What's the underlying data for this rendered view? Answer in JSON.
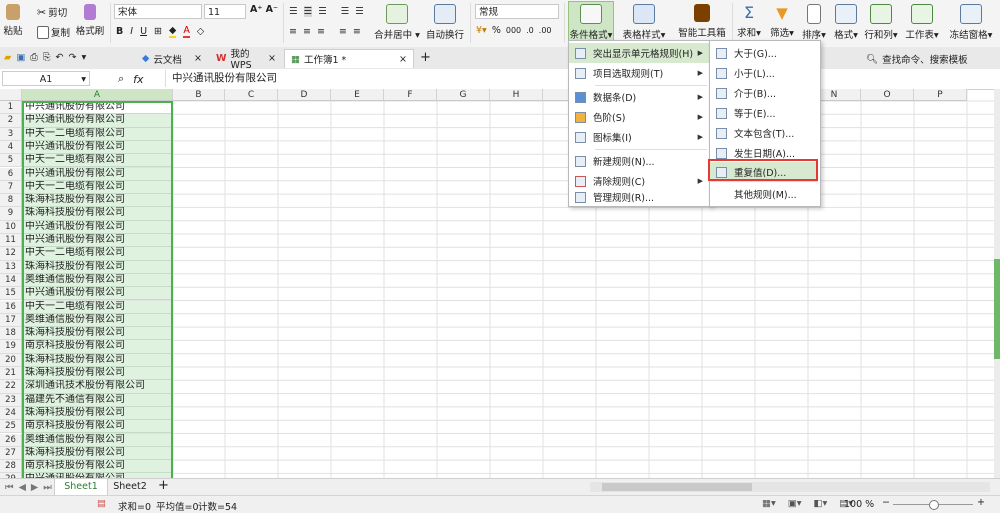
{
  "ribbon": {
    "cut": "剪切",
    "paste": "粘贴",
    "copy": "复制",
    "format_painter": "格式刷",
    "font_name": "宋体",
    "font_size": "11",
    "number_format": "常规",
    "merge_center": "合并居中",
    "wrap_text": "自动换行",
    "conditional_format": "条件格式",
    "table_style": "表格样式",
    "smart_toolbox": "智能工具箱",
    "sum": "求和",
    "filter": "筛选",
    "sort": "排序",
    "format": "格式",
    "row_col": "行和列",
    "worksheet": "工作表",
    "freeze": "冻结窗格",
    "percent": "%",
    "thousands": "000"
  },
  "tabs": {
    "cloud": "云文档",
    "mywps": "我的WPS",
    "workbook": "工作簿1 *",
    "search": "查找命令、搜索模板"
  },
  "formula_bar": {
    "cell_ref": "A1",
    "fx": "fx",
    "content": "中兴通讯股份有限公司"
  },
  "columns": [
    "A",
    "B",
    "C",
    "D",
    "E",
    "F",
    "G",
    "H",
    "I",
    "J",
    "K",
    "L",
    "M",
    "N",
    "O",
    "P"
  ],
  "rows": [
    {
      "n": "1",
      "a": "中兴通讯股份有限公司"
    },
    {
      "n": "2",
      "a": "中兴通讯股份有限公司"
    },
    {
      "n": "3",
      "a": "中天一二电缆有限公司"
    },
    {
      "n": "4",
      "a": "中兴通讯股份有限公司"
    },
    {
      "n": "5",
      "a": "中天一二电缆有限公司"
    },
    {
      "n": "6",
      "a": "中兴通讯股份有限公司"
    },
    {
      "n": "7",
      "a": "中天一二电缆有限公司"
    },
    {
      "n": "8",
      "a": "珠海科技股份有限公司"
    },
    {
      "n": "9",
      "a": "珠海科技股份有限公司"
    },
    {
      "n": "10",
      "a": "中兴通讯股份有限公司"
    },
    {
      "n": "11",
      "a": "中兴通讯股份有限公司"
    },
    {
      "n": "12",
      "a": "中天一二电缆有限公司"
    },
    {
      "n": "13",
      "a": "珠海科技股份有限公司"
    },
    {
      "n": "14",
      "a": "奥维通信股份有限公司"
    },
    {
      "n": "15",
      "a": "中兴通讯股份有限公司"
    },
    {
      "n": "16",
      "a": "中天一二电缆有限公司"
    },
    {
      "n": "17",
      "a": "奥维通信股份有限公司"
    },
    {
      "n": "18",
      "a": "珠海科技股份有限公司"
    },
    {
      "n": "19",
      "a": "南京科技股份有限公司"
    },
    {
      "n": "20",
      "a": "珠海科技股份有限公司"
    },
    {
      "n": "21",
      "a": "珠海科技股份有限公司"
    },
    {
      "n": "22",
      "a": "深圳通讯技术股份有限公司"
    },
    {
      "n": "23",
      "a": "福建先不通信有限公司"
    },
    {
      "n": "24",
      "a": "珠海科技股份有限公司"
    },
    {
      "n": "25",
      "a": "南京科技股份有限公司"
    },
    {
      "n": "26",
      "a": "奥维通信股份有限公司"
    },
    {
      "n": "27",
      "a": "珠海科技股份有限公司"
    },
    {
      "n": "28",
      "a": "南京科技股份有限公司"
    },
    {
      "n": "29",
      "a": "中兴通讯股份有限公司"
    }
  ],
  "menu1": {
    "items": [
      "突出显示单元格规则(H)",
      "项目选取规则(T)",
      "数据条(D)",
      "色阶(S)",
      "图标集(I)",
      "新建规则(N)...",
      "清除规则(C)",
      "管理规则(R)..."
    ]
  },
  "menu2": {
    "items": [
      "大于(G)...",
      "小于(L)...",
      "介于(B)...",
      "等于(E)...",
      "文本包含(T)...",
      "发生日期(A)...",
      "重复值(D)...",
      "其他规则(M)..."
    ]
  },
  "sheets": {
    "sheet1": "Sheet1",
    "sheet2": "Sheet2",
    "add": "+"
  },
  "status": {
    "sum": "求和=0",
    "avg": "平均值=0",
    "count": "计数=54",
    "zoom": "100 %"
  },
  "colors": {
    "accent": "#4caf50",
    "highlight_red": "#e53935",
    "selection": "#dff2df"
  }
}
